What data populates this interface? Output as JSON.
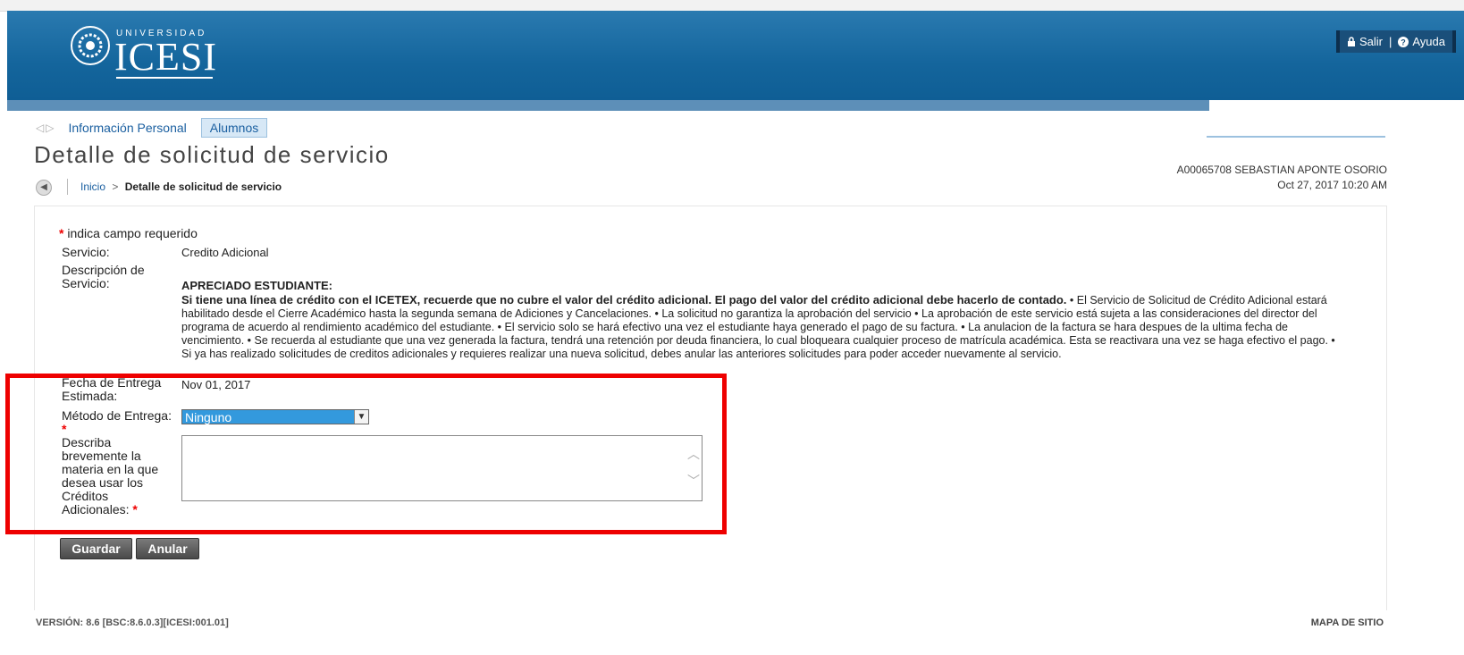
{
  "header": {
    "logo_top": "UNIVERSIDAD",
    "logo_name": "ICESI",
    "exit_label": "Salir",
    "help_label": "Ayuda"
  },
  "nav": {
    "tabs": [
      "Información Personal",
      "Alumnos"
    ]
  },
  "page": {
    "title": "Detalle de solicitud de servicio",
    "breadcrumb_home": "Inicio",
    "breadcrumb_sep": ">",
    "breadcrumb_current": "Detalle de solicitud de servicio",
    "user": "A00065708 SEBASTIAN APONTE OSORIO",
    "datetime": "Oct 27, 2017 10:20 AM"
  },
  "form": {
    "required_note": "indica campo requerido",
    "service_label": "Servicio:",
    "service_value": "Credito Adicional",
    "description_label": "Descripción de Servicio:",
    "desc_heading": "APRECIADO ESTUDIANTE:",
    "desc_bold": "Si tiene una línea de crédito con el ICETEX, recuerde que no cubre el valor del crédito adicional. El pago del valor del crédito adicional debe hacerlo de contado.",
    "desc_body": " • El Servicio de Solicitud de Crédito Adicional estará habilitado desde el Cierre Académico hasta la segunda semana de Adiciones y Cancelaciones. • La solicitud no garantiza la aprobación del servicio • La aprobación de este servicio está sujeta a las consideraciones del director del programa de acuerdo al rendimiento académico del estudiante. • El servicio solo se hará efectivo una vez el estudiante haya generado el pago de su factura. • La anulacion de la factura se hara despues de la ultima fecha de vencimiento. • Se recuerda al estudiante que una vez generada la factura, tendrá una retención por deuda financiera, lo cual bloqueara cualquier proceso de matrícula académica. Esta se reactivara una vez se haga efectivo el pago. • Si ya has realizado solicitudes de creditos adicionales y requieres realizar una nueva solicitud, debes anular las anteriores solicitudes para poder acceder nuevamente al servicio.",
    "delivery_date_label": "Fecha de Entrega Estimada:",
    "delivery_date_value": "Nov 01, 2017",
    "method_label": "Método de Entrega:",
    "method_value": "Ninguno",
    "subject_label": "Describa brevemente la materia en la que desea usar los Créditos Adicionales:",
    "subject_value": "",
    "save_button": "Guardar",
    "cancel_button": "Anular"
  },
  "footer": {
    "version": "VERSIÓN: 8.6 [BSC:8.6.0.3][ICESI:001.01]",
    "sitemap": "MAPA DE SITIO"
  },
  "colors": {
    "header_blue": "#14659c",
    "highlight_red": "#ee0000",
    "link_blue": "#1a5fa0"
  }
}
